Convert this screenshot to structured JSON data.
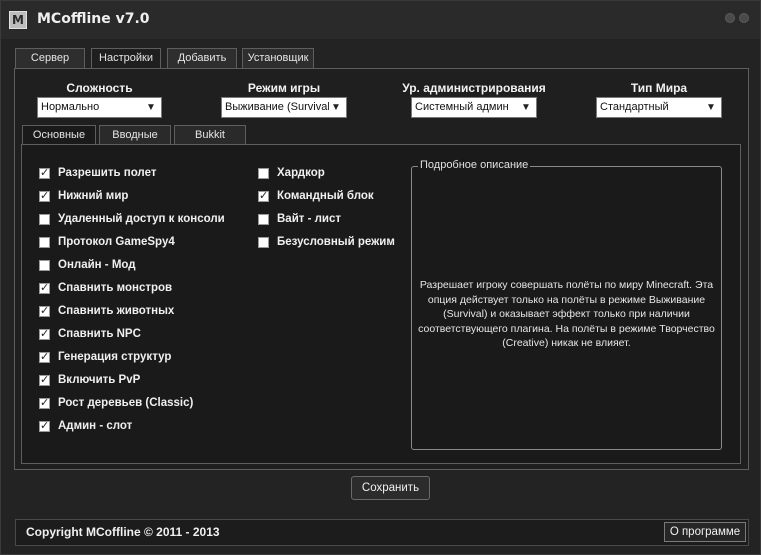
{
  "window": {
    "title": "MCoffline v7.0",
    "logo_letter": "M"
  },
  "top_tabs": [
    {
      "label": "Сервер",
      "active": false
    },
    {
      "label": "Настройки",
      "active": true
    },
    {
      "label": "Добавить",
      "active": false
    },
    {
      "label": "Установщик",
      "active": false
    }
  ],
  "settings": {
    "difficulty": {
      "label": "Сложность",
      "value": "Нормально"
    },
    "game_mode": {
      "label": "Режим игры",
      "value": "Выживание (Survival"
    },
    "admin_level": {
      "label": "Ур. администрирования",
      "value": "Системный админ"
    },
    "world_type": {
      "label": "Тип Мира",
      "value": "Стандартный"
    }
  },
  "sub_tabs": [
    {
      "label": "Основные",
      "active": true
    },
    {
      "label": "Вводные",
      "active": false
    },
    {
      "label": "Bukkit",
      "active": false
    }
  ],
  "options_left": [
    {
      "label": "Разрешить полет",
      "checked": true
    },
    {
      "label": "Нижний мир",
      "checked": true
    },
    {
      "label": "Удаленный доступ к консоли",
      "checked": false
    },
    {
      "label": "Протокол GameSpy4",
      "checked": false
    },
    {
      "label": "Онлайн - Мод",
      "checked": false
    },
    {
      "label": "Спавнить монстров",
      "checked": true
    },
    {
      "label": "Спавнить животных",
      "checked": true
    },
    {
      "label": "Спавнить NPC",
      "checked": true
    },
    {
      "label": "Генерация структур",
      "checked": true
    },
    {
      "label": "Включить PvP",
      "checked": true
    },
    {
      "label": "Рост деревьев (Classic)",
      "checked": true
    },
    {
      "label": "Админ - слот",
      "checked": true
    }
  ],
  "options_right": [
    {
      "label": "Хардкор",
      "checked": false
    },
    {
      "label": "Командный блок",
      "checked": true
    },
    {
      "label": "Вайт - лист",
      "checked": false
    },
    {
      "label": "Безусловный режим",
      "checked": false
    }
  ],
  "description": {
    "legend": "Подробное описание",
    "text": "Разрешает игроку совершать полёты по миру Minecraft. Эта опция действует только на полёты в режиме Выживание (Survival) и оказывает эффект только при наличии соответствующего плагина. На полёты в режиме Творчество (Creative) никак не влияет."
  },
  "save_label": "Сохранить",
  "footer": {
    "copyright": "Copyright MCoffline © 2011 - 2013",
    "about_label": "О программе"
  },
  "icons": {
    "dropdown": "chevron-down-icon",
    "checkbox": "check-icon",
    "minimize": "minimize-icon",
    "close": "close-icon"
  }
}
